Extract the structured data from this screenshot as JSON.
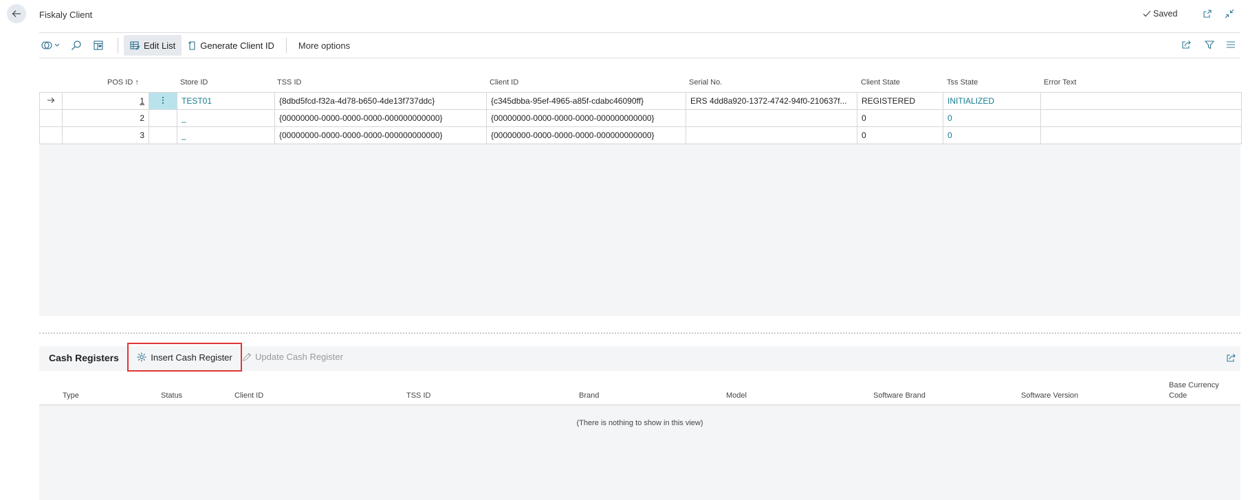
{
  "header": {
    "title": "Fiskaly Client",
    "saved_label": "Saved"
  },
  "toolbar": {
    "edit_list_label": "Edit List",
    "generate_client_id_label": "Generate Client ID",
    "more_options_label": "More options"
  },
  "main_table": {
    "columns": [
      "POS ID",
      "Store ID",
      "TSS ID",
      "Client ID",
      "Serial No.",
      "Client State",
      "Tss State",
      "Error Text"
    ],
    "sort_indicator": "↑",
    "rows": [
      {
        "pos_id": "1",
        "store_id": "TEST01",
        "tss_id": "{8dbd5fcd-f32a-4d78-b650-4de13f737ddc}",
        "client_id": "{c345dbba-95ef-4965-a85f-cdabc46090ff}",
        "serial_no": "ERS 4dd8a920-1372-4742-94f0-210637f...",
        "client_state": "REGISTERED",
        "tss_state": "INITIALIZED",
        "error_text": ""
      },
      {
        "pos_id": "2",
        "store_id": "_",
        "tss_id": "{00000000-0000-0000-0000-000000000000}",
        "client_id": "{00000000-0000-0000-0000-000000000000}",
        "serial_no": "",
        "client_state": "0",
        "tss_state": "0",
        "error_text": ""
      },
      {
        "pos_id": "3",
        "store_id": "_",
        "tss_id": "{00000000-0000-0000-0000-000000000000}",
        "client_id": "{00000000-0000-0000-0000-000000000000}",
        "serial_no": "",
        "client_state": "0",
        "tss_state": "0",
        "error_text": ""
      }
    ]
  },
  "cash_registers": {
    "title": "Cash Registers",
    "insert_label": "Insert Cash Register",
    "update_label": "Update Cash Register",
    "columns": [
      "Type",
      "Status",
      "Client ID",
      "TSS ID",
      "Brand",
      "Model",
      "Software Brand",
      "Software Version",
      "Base Currency",
      "Code"
    ],
    "empty_message": "(There is nothing to show in this view)"
  },
  "colors": {
    "accent": "#147a8f",
    "highlight_border": "#e03535",
    "selected_cell": "#b8e3ec"
  }
}
